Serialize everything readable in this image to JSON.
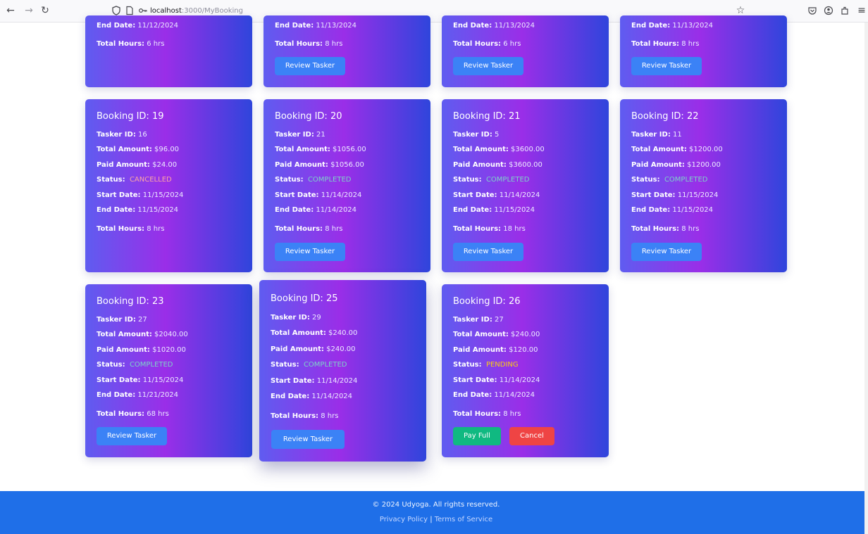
{
  "browser": {
    "url_host": "localhost",
    "url_path": ":3000/MyBooking"
  },
  "labels": {
    "booking_id": "Booking ID:",
    "tasker_id": "Tasker ID:",
    "total_amount": "Total Amount:",
    "paid_amount": "Paid Amount:",
    "status": "Status:",
    "start_date": "Start Date:",
    "end_date": "End Date:",
    "total_hours": "Total Hours:",
    "review_tasker": "Review Tasker",
    "pay_full": "Pay Full",
    "cancel": "Cancel"
  },
  "top_row": [
    {
      "end_date": "11/12/2024",
      "total_hours": "6 hrs"
    },
    {
      "end_date": "11/13/2024",
      "total_hours": "8 hrs"
    },
    {
      "end_date": "11/13/2024",
      "total_hours": "6 hrs"
    },
    {
      "end_date": "11/13/2024",
      "total_hours": "8 hrs"
    }
  ],
  "bookings": [
    {
      "title": "Booking ID: 19",
      "tasker_id": "16",
      "total_amount": "$96.00",
      "paid_amount": "$24.00",
      "status": "CANCELLED",
      "start_date": "11/15/2024",
      "end_date": "11/15/2024",
      "total_hours": "8 hrs"
    },
    {
      "title": "Booking ID: 20",
      "tasker_id": "21",
      "total_amount": "$1056.00",
      "paid_amount": "$1056.00",
      "status": "COMPLETED",
      "start_date": "11/14/2024",
      "end_date": "11/14/2024",
      "total_hours": "8 hrs"
    },
    {
      "title": "Booking ID: 21",
      "tasker_id": "5",
      "total_amount": "$3600.00",
      "paid_amount": "$3600.00",
      "status": "COMPLETED",
      "start_date": "11/14/2024",
      "end_date": "11/15/2024",
      "total_hours": "18 hrs"
    },
    {
      "title": "Booking ID: 22",
      "tasker_id": "11",
      "total_amount": "$1200.00",
      "paid_amount": "$1200.00",
      "status": "COMPLETED",
      "start_date": "11/15/2024",
      "end_date": "11/15/2024",
      "total_hours": "8 hrs"
    },
    {
      "title": "Booking ID: 23",
      "tasker_id": "27",
      "total_amount": "$2040.00",
      "paid_amount": "$1020.00",
      "status": "COMPLETED",
      "start_date": "11/15/2024",
      "end_date": "11/21/2024",
      "total_hours": "68 hrs"
    },
    {
      "title": "Booking ID: 25",
      "tasker_id": "29",
      "total_amount": "$240.00",
      "paid_amount": "$240.00",
      "status": "COMPLETED",
      "start_date": "11/14/2024",
      "end_date": "11/14/2024",
      "total_hours": "8 hrs"
    },
    {
      "title": "Booking ID: 26",
      "tasker_id": "27",
      "total_amount": "$240.00",
      "paid_amount": "$120.00",
      "status": "PENDING",
      "start_date": "11/14/2024",
      "end_date": "11/14/2024",
      "total_hours": "8 hrs"
    }
  ],
  "colors": {
    "completed": "#7dd3c8",
    "cancelled": "#fca5a5",
    "pending": "#facc15",
    "footer": "#1f6fe8",
    "review_button": "#3b82f6",
    "pay_button": "#10b981",
    "cancel_button": "#ef4444"
  },
  "footer": {
    "copyright": "© 2024 Udyoga. All rights reserved.",
    "privacy": "Privacy Policy",
    "separator": "|",
    "terms": "Terms of Service"
  }
}
